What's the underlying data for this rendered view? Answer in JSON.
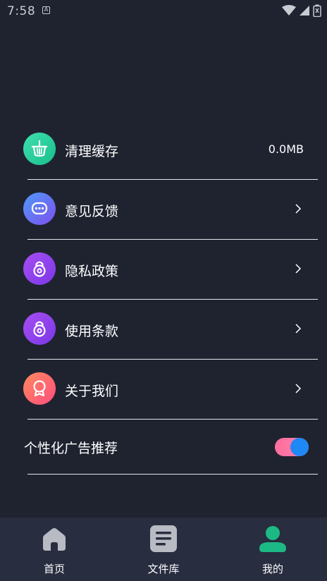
{
  "status_bar": {
    "time": "7:58"
  },
  "menu": {
    "items": [
      {
        "label": "清理缓存",
        "value": "0.0MB",
        "icon": "broom-basket-icon",
        "colors": [
          "#38d6a5",
          "#1ec28d"
        ]
      },
      {
        "label": "意见反馈",
        "icon": "chat-bubble-icon",
        "colors": [
          "#5b86f5",
          "#7b5cf0"
        ]
      },
      {
        "label": "隐私政策",
        "icon": "lock-icon",
        "colors": [
          "#a04cf0",
          "#7b3ae8"
        ]
      },
      {
        "label": "使用条款",
        "icon": "lock-icon",
        "colors": [
          "#a04cf0",
          "#7b3ae8"
        ]
      },
      {
        "label": "关于我们",
        "icon": "award-ribbon-icon",
        "colors": [
          "#ff7a6a",
          "#ff4f7a"
        ]
      }
    ],
    "toggle": {
      "label": "个性化广告推荐",
      "on": true,
      "track_color": "#ff7fb0",
      "thumb_color": "#1e88f5"
    }
  },
  "bottom_nav": {
    "items": [
      {
        "label": "首页",
        "icon": "home-icon",
        "active": false
      },
      {
        "label": "文件库",
        "icon": "file-list-icon",
        "active": false
      },
      {
        "label": "我的",
        "icon": "user-icon",
        "active": true
      }
    ],
    "active_color": "#1db985",
    "inactive_color": "#b8bbc4"
  }
}
